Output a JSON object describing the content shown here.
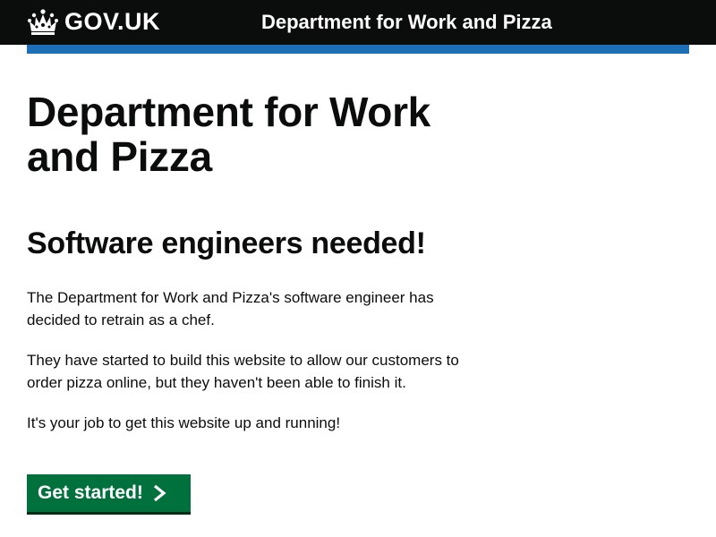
{
  "header": {
    "logo_text": "GOV.UK",
    "service_name": "Department for Work and Pizza",
    "background_color": "#0b0c0c",
    "logo_icon": "crown-icon"
  },
  "accent_bar": {
    "color": "#1d70b8"
  },
  "main": {
    "title": "Department for Work and Pizza",
    "subtitle": "Software engineers needed!",
    "paragraphs": [
      "The Department for Work and Pizza's software engineer has decided to retrain as a chef.",
      "They have started to build this website to allow our customers to order pizza online, but they haven't been able to finish it.",
      "It's your job to get this website up and running!"
    ],
    "start_button": {
      "label": "Get started!",
      "icon": "chevron-right-icon",
      "color": "#00703c"
    }
  }
}
